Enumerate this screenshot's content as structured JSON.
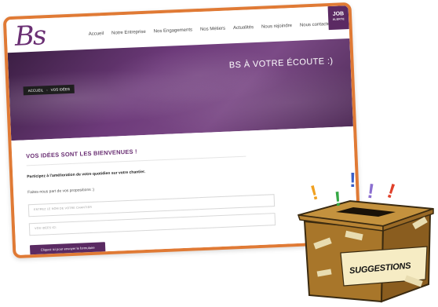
{
  "site": {
    "logo_text": "Bs",
    "nav": [
      "Accueil",
      "Notre Entreprise",
      "Nos Engagements",
      "Nos Métiers",
      "Actualités",
      "Nous rejoindre",
      "Nous contacter"
    ],
    "job_badge": {
      "big": "JOB",
      "small": "ALERTE"
    }
  },
  "hero": {
    "title": "BS À VOTRE ÉCOUTE :)",
    "breadcrumb": {
      "home": "ACCUEIL",
      "current": "VOS IDÉES"
    }
  },
  "content": {
    "heading": "VOS IDÉES SONT LES BIENVENUES !",
    "intro_bold": "Participez à l'amélioration de votre quotidien sur votre chantier.",
    "intro": "Faites-nous part de vos propositions :)",
    "field1_placeholder": "ENTREZ LE NOM DE VOTRE CHANTIER",
    "field2_placeholder": "VOS IDÉES ICI",
    "submit_label": "Cliquez ici pour envoyer le formulaire"
  },
  "suggestion_box": {
    "label": "SUGGESTIONS",
    "marks": [
      "!",
      "!",
      "!",
      "!",
      "!"
    ]
  },
  "colors": {
    "frame_border": "#e07a35",
    "brand_purple": "#6a2f73",
    "box_wood": "#a8762a"
  }
}
